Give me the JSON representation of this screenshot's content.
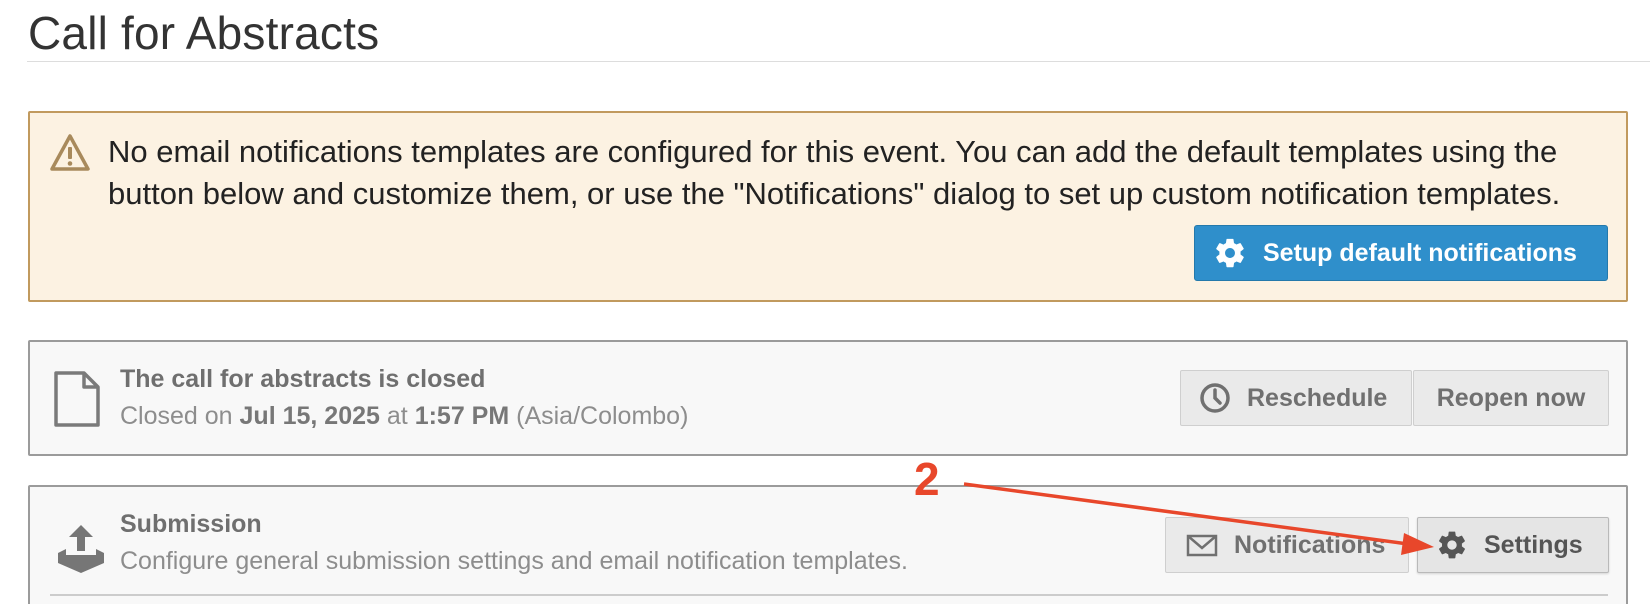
{
  "page": {
    "title": "Call for Abstracts"
  },
  "warning": {
    "line1": "No email notifications templates are configured for this event. You can add the default templates using the",
    "line2": "button below and customize them, or use the \"Notifications\" dialog to set up custom notification templates.",
    "button_label": "Setup default notifications",
    "icon": "warning-triangle-icon",
    "background": "#fcf2e2",
    "border": "#c19a5e"
  },
  "cfa_status": {
    "title": "The call for abstracts is closed",
    "closed_prefix": "Closed on",
    "closed_date": "Jul 15, 2025",
    "closed_at": "at",
    "closed_time": "1:57 PM",
    "timezone": "(Asia/Colombo)",
    "icon": "document-icon",
    "reschedule_label": "Reschedule",
    "reschedule_icon": "clock-icon",
    "reopen_label": "Reopen now"
  },
  "submission": {
    "title": "Submission",
    "description": "Configure general submission settings and email notification templates.",
    "icon": "upload-tray-icon",
    "notifications_label": "Notifications",
    "notifications_icon": "envelope-icon",
    "settings_label": "Settings",
    "settings_icon": "gear-icon"
  },
  "annotation": {
    "step_label": "2",
    "color": "#e8472b"
  },
  "colors": {
    "primary_button": "#2f8fcb",
    "panel_background": "#f8f8f8",
    "panel_border": "#9b9b9b"
  }
}
